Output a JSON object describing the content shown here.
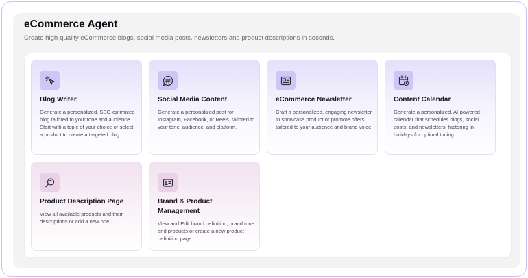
{
  "page": {
    "title": "eCommerce Agent",
    "subtitle": "Create high-quality eCommerce blogs, social media posts, newsletters and product descriptions in seconds."
  },
  "cards": [
    {
      "title": "Blog Writer",
      "description": "Generate a personalized, SEO-optimized blog tailored to your tone and audience. Start with a topic of your choice or select a product to create a targeted blog.",
      "icon": "cursor-click-icon"
    },
    {
      "title": "Social Media Content",
      "description": "Generate a personalized post for Instagram, Facebook, or Reels, tailored to your tone, audience, and platform.",
      "icon": "hashtag-chat-icon"
    },
    {
      "title": "eCommerce Newsletter",
      "description": "Craft a personalized, engaging newsletter to showcase product or promote offers, tailored to your audience and brand voice.",
      "icon": "newsletter-icon"
    },
    {
      "title": "Content Calendar",
      "description": "Generate a personalized, AI-powered calendar that schedules blogs, social posts, and newsletters, factoring in holidays for optimal timing.",
      "icon": "calendar-clock-icon"
    },
    {
      "title": "Product Description Page",
      "description": "View all available products and their descriptions or add a new one.",
      "icon": "product-search-icon"
    },
    {
      "title": "Brand & Product Management",
      "description": "View and Edit brand definition, brand tone and products or create a new product definition page.",
      "icon": "brand-card-icon"
    }
  ],
  "colors": {
    "purple_card_top": "#e5e0fb",
    "pink_card_top": "#f1e2ef",
    "purple_icon_bg": "#cfc5f6",
    "pink_icon_bg": "#ead1e8",
    "icon_stroke": "#2e2e3a"
  }
}
